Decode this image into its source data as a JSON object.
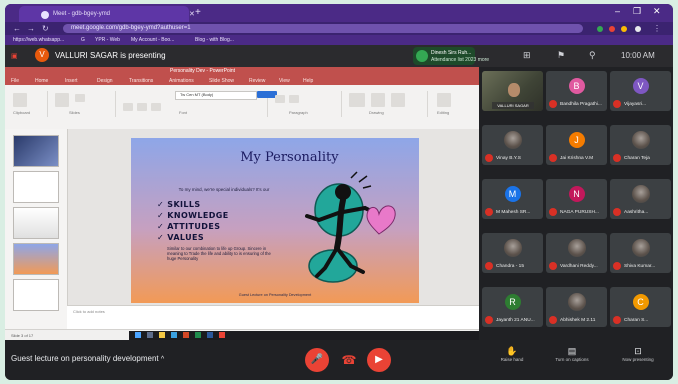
{
  "browser": {
    "tab_title": "Meet - gdb-bgey-ymd",
    "url": "meet.google.com/gdb-bgey-ymd?authuser=1",
    "bookmarks": [
      "https://web.whatsapp...",
      "G",
      "YPR - Web",
      "My Account - Boo...",
      "Blog - with Blog..."
    ],
    "window_controls": [
      "–",
      "❐",
      "✕"
    ]
  },
  "meet": {
    "presenter_initial": "V",
    "presenter_text": "VALLURI SAGAR is presenting",
    "share_line1": "Dinesh Sirs Ruh...",
    "share_line2": "Attendance list 2023 more",
    "clock": "10:00 AM",
    "meeting_title": "Guest lecture on personality development",
    "controls": {
      "raise_hand": "Raise hand",
      "turn_on_captions": "Turn on captions",
      "now_presenting": "Now presenting"
    }
  },
  "powerpoint": {
    "title": "Personality Dev - PowerPoint",
    "menu": [
      "File",
      "Home",
      "Insert",
      "Design",
      "Transitions",
      "Animations",
      "Slide Show",
      "Review",
      "View",
      "Help"
    ],
    "ribbon_groups": [
      "Clipboard",
      "Slides",
      "Font",
      "Paragraph",
      "Drawing",
      "Editing"
    ],
    "font_name": "Tw Cen MT (Body)",
    "notes_placeholder": "Click to add notes",
    "status_left": "Slide 3 of 17",
    "status_right": "Notes",
    "zoom": "74%",
    "slide": {
      "title": "My Personality",
      "intro": "To my mind, we're special individuals? It's our",
      "bullets": [
        "✓ SKILLS",
        "✓ KNOWLEDGE",
        "✓ ATTITUDES",
        "✓ VALUES"
      ],
      "small_text": "Similar to our combination to life up Group. Sincere in meaning to Trade the life and ability to is ensuring of the huge Personality",
      "footer": "Guest Lecture on Personality Development"
    }
  },
  "participants": [
    {
      "name": "VALLURI SAGAR",
      "initial": "",
      "type": "self-camera",
      "color": ""
    },
    {
      "name": "Bandhila Pragathi...",
      "initial": "B",
      "type": "avatar",
      "color": "#e05aa0"
    },
    {
      "name": "Vijayasri...",
      "initial": "V",
      "type": "avatar",
      "color": "#7e57c2"
    },
    {
      "name": "Vinay B.Y.S",
      "initial": "",
      "type": "photo",
      "color": ""
    },
    {
      "name": "Jai Krishna V.M",
      "initial": "J",
      "type": "avatar",
      "color": "#f57c00"
    },
    {
      "name": "Charan Teja",
      "initial": "",
      "type": "photo",
      "color": ""
    },
    {
      "name": "M Mahesh SR...",
      "initial": "M",
      "type": "avatar",
      "color": "#1a73e8"
    },
    {
      "name": "NAGA PURUSH...",
      "initial": "N",
      "type": "avatar",
      "color": "#c2185b"
    },
    {
      "name": "Aashritha...",
      "initial": "",
      "type": "photo",
      "color": ""
    },
    {
      "name": "Chandra - 15",
      "initial": "",
      "type": "photo",
      "color": ""
    },
    {
      "name": "Vardhani Reddy...",
      "initial": "",
      "type": "photo",
      "color": ""
    },
    {
      "name": "Shiva Kumar...",
      "initial": "",
      "type": "photo",
      "color": ""
    },
    {
      "name": "Jayanth 21 ANU...",
      "initial": "R",
      "type": "avatar",
      "color": "#2e7d32"
    },
    {
      "name": "Abhishek M 2.11",
      "initial": "",
      "type": "photo",
      "color": ""
    },
    {
      "name": "Charan S...",
      "initial": "C",
      "type": "avatar",
      "color": "#f29900"
    }
  ]
}
